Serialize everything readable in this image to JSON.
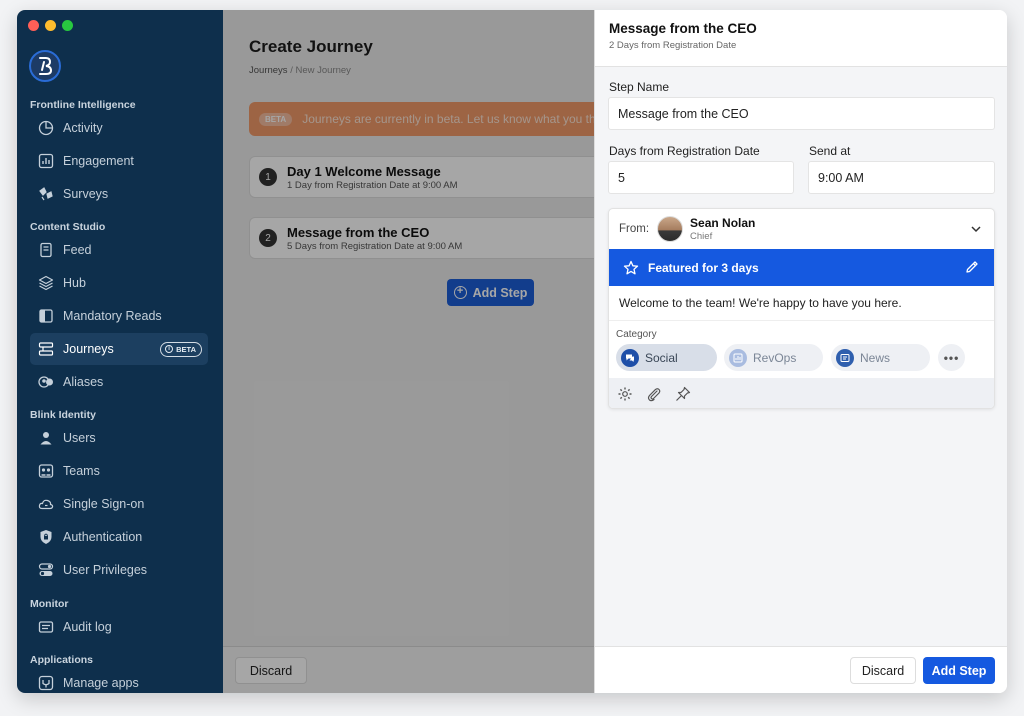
{
  "colors": {
    "sidebar_bg": "#0e2f4c",
    "accent": "#1559e0",
    "banner": "#f19a69",
    "traffic_red": "#ff5f57",
    "traffic_yellow": "#febc2e",
    "traffic_green": "#28c840"
  },
  "sidebar": {
    "sections": [
      {
        "label": "Frontline Intelligence",
        "items": [
          {
            "label": "Activity",
            "icon": "pie-chart-icon"
          },
          {
            "label": "Engagement",
            "icon": "bar-chart-icon"
          },
          {
            "label": "Surveys",
            "icon": "survey-icon"
          }
        ]
      },
      {
        "label": "Content Studio",
        "items": [
          {
            "label": "Feed",
            "icon": "feed-icon"
          },
          {
            "label": "Hub",
            "icon": "layers-icon"
          },
          {
            "label": "Mandatory Reads",
            "icon": "book-icon"
          },
          {
            "label": "Journeys",
            "icon": "journey-icon",
            "badge": "BETA",
            "active": true
          },
          {
            "label": "Aliases",
            "icon": "alias-icon"
          }
        ]
      },
      {
        "label": "Blink Identity",
        "items": [
          {
            "label": "Users",
            "icon": "user-icon"
          },
          {
            "label": "Teams",
            "icon": "teams-icon"
          },
          {
            "label": "Single Sign-on",
            "icon": "cloud-icon"
          },
          {
            "label": "Authentication",
            "icon": "lock-icon"
          },
          {
            "label": "User Privileges",
            "icon": "toggle-icon"
          }
        ]
      },
      {
        "label": "Monitor",
        "items": [
          {
            "label": "Audit log",
            "icon": "audit-icon"
          }
        ]
      },
      {
        "label": "Applications",
        "items": [
          {
            "label": "Manage apps",
            "icon": "apps-icon"
          }
        ]
      }
    ]
  },
  "main": {
    "title": "Create Journey",
    "breadcrumb": {
      "root": "Journeys",
      "sep": "/",
      "current": "New Journey"
    },
    "banner": {
      "pill": "BETA",
      "text": "Journeys are currently in beta. Let us know what you think"
    },
    "steps": [
      {
        "number": "1",
        "title": "Day 1 Welcome Message",
        "subtitle": "1 Day from Registration Date at 9:00 AM"
      },
      {
        "number": "2",
        "title": "Message from the CEO",
        "subtitle": "5 Days from Registration Date at 9:00 AM"
      }
    ],
    "add_step_label": "Add Step",
    "discard_label": "Discard"
  },
  "panel": {
    "title": "Message from the CEO",
    "subtitle": "2 Days from Registration Date",
    "step_name_label": "Step Name",
    "step_name_value": "Message from the CEO",
    "days_label": "Days from Registration Date",
    "days_value": "5",
    "send_at_label": "Send at",
    "send_at_value": "9:00 AM",
    "message": {
      "from_label": "From:",
      "sender_name": "Sean Nolan",
      "sender_role": "Chief",
      "featured_text": "Featured for 3 days",
      "body": "Welcome to the team! We're happy to have you here.",
      "category_label": "Category",
      "categories": [
        {
          "label": "Social",
          "selected": true
        },
        {
          "label": "RevOps",
          "selected": false
        },
        {
          "label": "News",
          "selected": false
        }
      ],
      "more_label": "•••"
    },
    "discard_label": "Discard",
    "add_step_label": "Add Step"
  }
}
